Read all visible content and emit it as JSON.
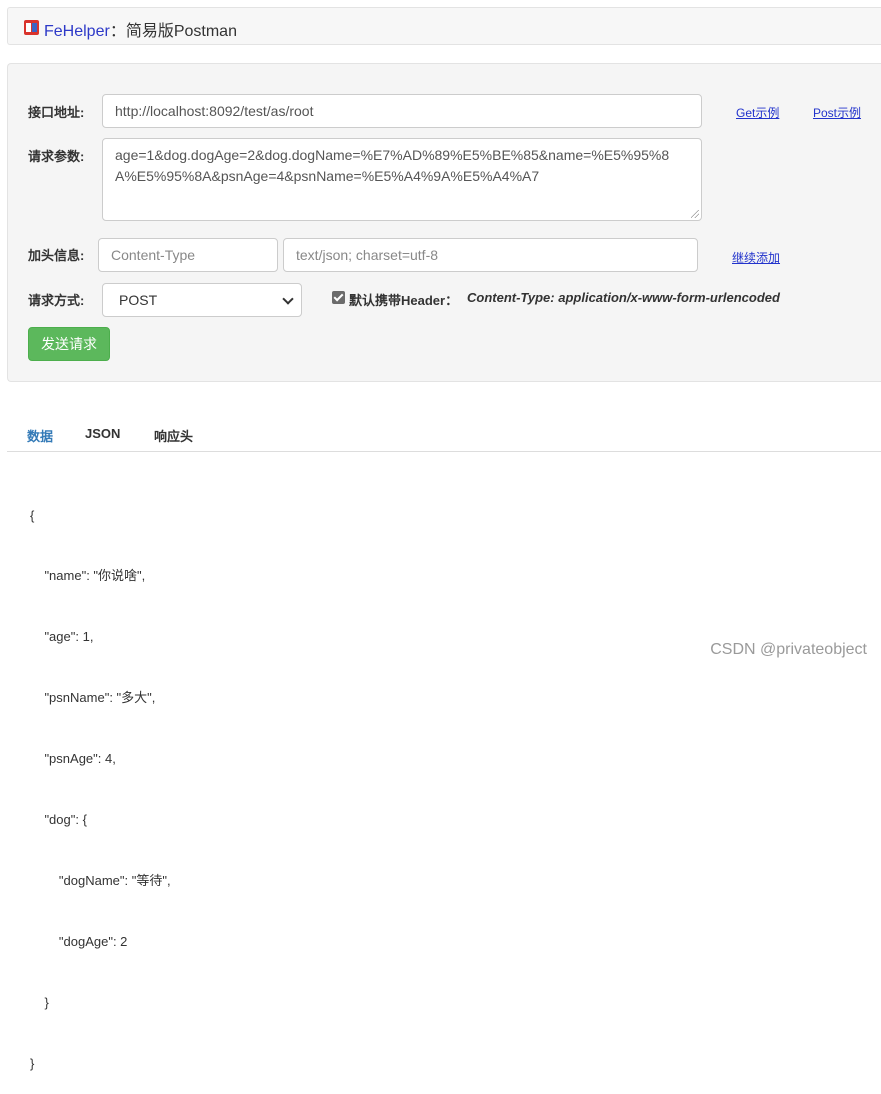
{
  "header": {
    "brand": "FeHelper",
    "separator": "：",
    "subtitle": "简易版Postman"
  },
  "form": {
    "url_label": "接口地址:",
    "url_value": "http://localhost:8092/test/as/root",
    "get_example": "Get示例",
    "post_example": "Post示例",
    "params_label": "请求参数:",
    "params_value": "age=1&dog.dogAge=2&dog.dogName=%E7%AD%89%E5%BE%85&name=%E5%95%8A%E5%95%8A&psnAge=4&psnName=%E5%A4%9A%E5%A4%A7",
    "header_label": "加头信息:",
    "header_key_placeholder": "Content-Type",
    "header_value_placeholder": "text/json; charset=utf-8",
    "add_more": "继续添加",
    "method_label": "请求方式:",
    "method_value": "POST",
    "default_header_label": "默认携带Header：",
    "default_header_value": "Content-Type: application/x-www-form-urlencoded",
    "send_button": "发送请求"
  },
  "tabs": [
    {
      "label": "数据",
      "active": true
    },
    {
      "label": "JSON",
      "active": false
    },
    {
      "label": "响应头",
      "active": false
    }
  ],
  "response_lines": [
    "{",
    "    \"name\": \"你说啥\",",
    "    \"age\": 1,",
    "    \"psnName\": \"多大\",",
    "    \"psnAge\": 4,",
    "    \"dog\": {",
    "        \"dogName\": \"等待\",",
    "        \"dogAge\": 2",
    "    }",
    "}"
  ],
  "watermark": "CSDN @privateobject",
  "colors": {
    "accent_blue": "#337ab7",
    "button_green": "#5cb85c",
    "brand_blue": "#2d39c8",
    "logo_red": "#d9332c"
  }
}
